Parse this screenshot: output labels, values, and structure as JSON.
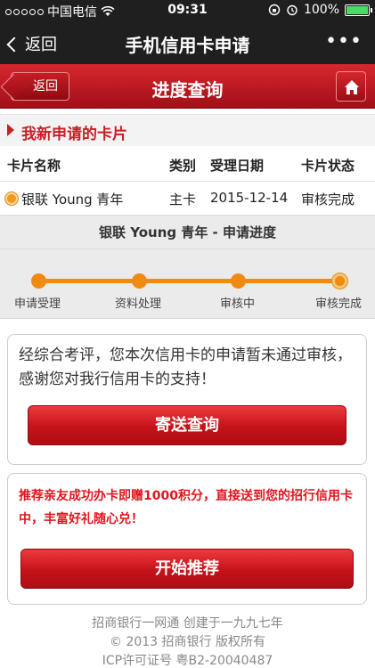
{
  "status_bar": {
    "carrier": "中国电信",
    "time": "09:31",
    "battery": "100%"
  },
  "nav": {
    "back_label": "返回",
    "title": "手机信用卡申请",
    "more": "•••"
  },
  "header": {
    "back_label": "返回",
    "title": "进度查询",
    "home_icon": "home-icon"
  },
  "section": {
    "title": "我新申请的卡片"
  },
  "table": {
    "columns": [
      "卡片名称",
      "类别",
      "受理日期",
      "卡片状态"
    ],
    "rows": [
      {
        "name": "银联 Young 青年",
        "type": "主卡",
        "date": "2015-12-14",
        "status": "审核完成"
      }
    ]
  },
  "progress": {
    "title": "银联 Young 青年 - 申请进度",
    "steps": [
      "申请受理",
      "资料处理",
      "审核中",
      "审核完成"
    ],
    "current_step": 4,
    "color": "#f08a13"
  },
  "result_card": {
    "message": "经综合考评，您本次信用卡的申请暂未通过审核，感谢您对我行信用卡的支持！",
    "button": "寄送查询"
  },
  "promo_card": {
    "message": "推荐亲友成功办卡即赠1000积分，直接送到您的招行信用卡中，丰富好礼随心兑！",
    "button": "开始推荐"
  },
  "footer": {
    "line1": "招商银行一网通 创建于一九九七年",
    "line2": "© 2013 招商银行 版权所有",
    "line3": "ICP许可证号 粤B2-20040487"
  },
  "colors": {
    "brand_red": "#c81e27",
    "status_green": "#4cd964"
  }
}
